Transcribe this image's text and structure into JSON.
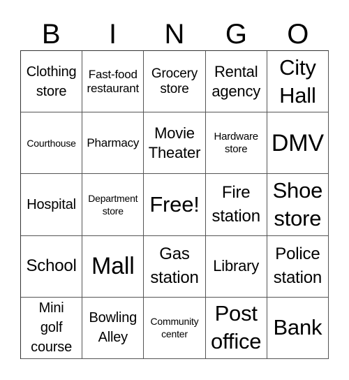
{
  "title_letters": [
    "B",
    "I",
    "N",
    "G",
    "O"
  ],
  "cells": [
    [
      {
        "text": "Clothing\nstore",
        "size": "s20"
      },
      {
        "text": "Fast-food\nrestaurant",
        "size": "s17"
      },
      {
        "text": "Grocery\nstore",
        "size": "s19"
      },
      {
        "text": "Rental\nagency",
        "size": "s22"
      },
      {
        "text": "City\nHall",
        "size": "s30"
      }
    ],
    [
      {
        "text": "Courthouse",
        "size": "s14"
      },
      {
        "text": "Pharmacy",
        "size": "s17"
      },
      {
        "text": "Movie\nTheater",
        "size": "s22"
      },
      {
        "text": "Hardware\nstore",
        "size": "s15"
      },
      {
        "text": "DMV",
        "size": "s34"
      }
    ],
    [
      {
        "text": "Hospital",
        "size": "s20"
      },
      {
        "text": "Department\nstore",
        "size": "s14"
      },
      {
        "text": "Free!",
        "size": "s30"
      },
      {
        "text": "Fire\nstation",
        "size": "s24"
      },
      {
        "text": "Shoe\nstore",
        "size": "s30"
      }
    ],
    [
      {
        "text": "School",
        "size": "s24"
      },
      {
        "text": "Mall",
        "size": "s34"
      },
      {
        "text": "Gas\nstation",
        "size": "s24"
      },
      {
        "text": "Library",
        "size": "s22"
      },
      {
        "text": "Police\nstation",
        "size": "s24"
      }
    ],
    [
      {
        "text": "Mini\ngolf\ncourse",
        "size": "s20"
      },
      {
        "text": "Bowling\nAlley",
        "size": "s20"
      },
      {
        "text": "Community\ncenter",
        "size": "s14"
      },
      {
        "text": "Post\noffice",
        "size": "s30"
      },
      {
        "text": "Bank",
        "size": "s30"
      }
    ]
  ]
}
